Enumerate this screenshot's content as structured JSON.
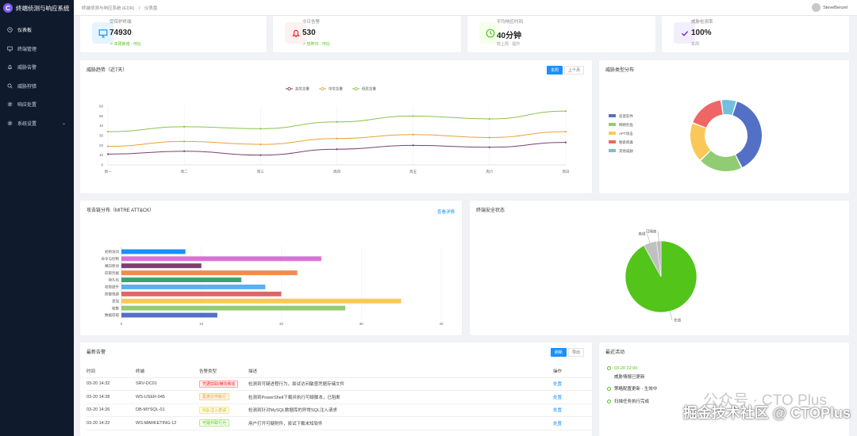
{
  "app": {
    "logo_letter": "C",
    "title": "终端侦测与响应系统"
  },
  "sidebar": {
    "items": [
      {
        "label": "仪表板",
        "icon": "clock-icon"
      },
      {
        "label": "终端管理",
        "icon": "monitor-icon"
      },
      {
        "label": "威胁告警",
        "icon": "bell-icon"
      },
      {
        "label": "威胁狩猎",
        "icon": "search-icon"
      },
      {
        "label": "响应处置",
        "icon": "gear-icon"
      },
      {
        "label": "系统设置",
        "icon": "gear-icon",
        "caret": "⌄"
      }
    ]
  },
  "header": {
    "breadcrumb": [
      "终端侦测与响应系统 (EDR)",
      "仪表盘"
    ],
    "separator": "/",
    "user_name": "SteveBenzel"
  },
  "stats": [
    {
      "label": "受保护终端",
      "value": "74930",
      "sub": "↗ 本周新增 · 环比",
      "icon": "monitor-icon",
      "icon_color": "#1890ff",
      "icon_bg": "#e6f4ff",
      "sub_style": "green"
    },
    {
      "label": "今日告警",
      "value": "530",
      "sub": "↗ 较昨日 · 环比",
      "icon": "bell-icon",
      "icon_color": "#f5222d",
      "icon_bg": "#fff1f0",
      "sub_style": "green"
    },
    {
      "label": "平均响应时间",
      "value": "40分钟",
      "sub": "较上周 · 提升",
      "icon": "clock-icon",
      "icon_color": "#52c41a",
      "icon_bg": "#f6ffed",
      "sub_style": "grey"
    },
    {
      "label": "威胁检测率",
      "value": "100%",
      "sub": "本周",
      "icon": "check-icon",
      "icon_color": "#722ed1",
      "icon_bg": "#f3eefe",
      "sub_style": "grey"
    }
  ],
  "trend_card": {
    "title": "威胁趋势（近7天）",
    "buttons": [
      "本周",
      "上个月"
    ]
  },
  "type_card": {
    "title": "威胁类型分布"
  },
  "attack_card": {
    "title": "攻击链分布（MITRE ATT&CK）",
    "link": "查看详情"
  },
  "endpoint_card": {
    "title": "终端安全状态"
  },
  "alerts_card": {
    "title": "最新告警",
    "buttons": [
      "刷新",
      "导出"
    ],
    "columns": [
      "时间",
      "终端",
      "告警类型",
      "描述",
      "操作"
    ],
    "rows": [
      {
        "time": "03-20 14:32",
        "host": "SRV-DC01",
        "type": "凭据窃取/横向移动",
        "type_style": "red",
        "desc": "检测到可疑进程行为，尝试访问敏感凭据存储文件",
        "op": "处置"
      },
      {
        "time": "03-20 14:28",
        "host": "WS-USER-045",
        "type": "恶意文件执行",
        "type_style": "orange",
        "desc": "检测到PowerShell下载并执行可疑脚本，已阻断",
        "op": "处置"
      },
      {
        "time": "03-20 14:26",
        "host": "DB-MYSQL-01",
        "type": "SQL注入尝试",
        "type_style": "yellow",
        "desc": "检测到针对MySQL数据库的异常SQL注入请求",
        "op": "处置"
      },
      {
        "time": "03-20 14:22",
        "host": "WS-MARKETING-12",
        "type": "可疑外联行为",
        "type_style": "green",
        "desc": "用户打开可疑附件，尝试下载未知软件",
        "op": "处置"
      }
    ]
  },
  "activity_card": {
    "title": "最近活动",
    "items": [
      {
        "time": "03-20 22:00",
        "text": "威胁情报已更新"
      },
      {
        "time": "",
        "text": "策略配置更新 · 生效中"
      },
      {
        "time": "",
        "text": "扫描任务执行完成"
      }
    ]
  },
  "watermarks": {
    "gzh": "公众号 · CTO Plus",
    "community": "掘金技术社区 @ CTOPlus"
  },
  "chart_data": [
    {
      "type": "line",
      "title": "",
      "categories": [
        "周一",
        "周二",
        "周三",
        "周四",
        "周五",
        "周六",
        "周日"
      ],
      "ylim": [
        0,
        60
      ],
      "yticks": [
        0,
        10,
        20,
        30,
        40,
        50,
        60
      ],
      "legend_position": "top-center",
      "grid": "vertical",
      "series": [
        {
          "name": "高危告警",
          "color": "#7b3f6e",
          "values": [
            11,
            14,
            10,
            16,
            20,
            18,
            23
          ]
        },
        {
          "name": "中危告警",
          "color": "#e6a23c",
          "values": [
            19,
            24,
            21,
            27,
            31,
            28,
            34
          ]
        },
        {
          "name": "低危告警",
          "color": "#8bc34a",
          "values": [
            34,
            39,
            37,
            44,
            50,
            47,
            55
          ]
        }
      ]
    },
    {
      "type": "pie",
      "donut": true,
      "legend_position": "left",
      "categories": [
        "恶意软件",
        "网络钓鱼",
        "APT攻击",
        "勒索病毒",
        "其他威胁"
      ],
      "colors": [
        "#5470c6",
        "#91cc75",
        "#fac858",
        "#ee6666",
        "#73c0de"
      ],
      "values": [
        38,
        20,
        18,
        17,
        7
      ]
    },
    {
      "type": "bar",
      "orientation": "horizontal",
      "xlim": [
        0,
        40
      ],
      "xticks": [
        0,
        10,
        20,
        30,
        40
      ],
      "grid": "vertical",
      "categories": [
        "初始访问",
        "命令与控制",
        "横向移动",
        "窃取凭据",
        "持久化",
        "权限提升",
        "防御规避",
        "发现",
        "收集",
        "数据窃取"
      ],
      "colors": [
        "#1890ff",
        "#da70d6",
        "#7b3f6e",
        "#f08c4e",
        "#3ba272",
        "#5ab1ef",
        "#e06666",
        "#fac858",
        "#91cc75",
        "#5470c6"
      ],
      "values": [
        8,
        25,
        10,
        22,
        15,
        18,
        20,
        35,
        28,
        12
      ]
    },
    {
      "type": "pie",
      "categories": [
        "在线",
        "离线",
        "已隔离"
      ],
      "colors": [
        "#52c41a",
        "#c0c0c0",
        "#bcbcbc"
      ],
      "values": [
        92,
        6,
        2
      ]
    }
  ]
}
